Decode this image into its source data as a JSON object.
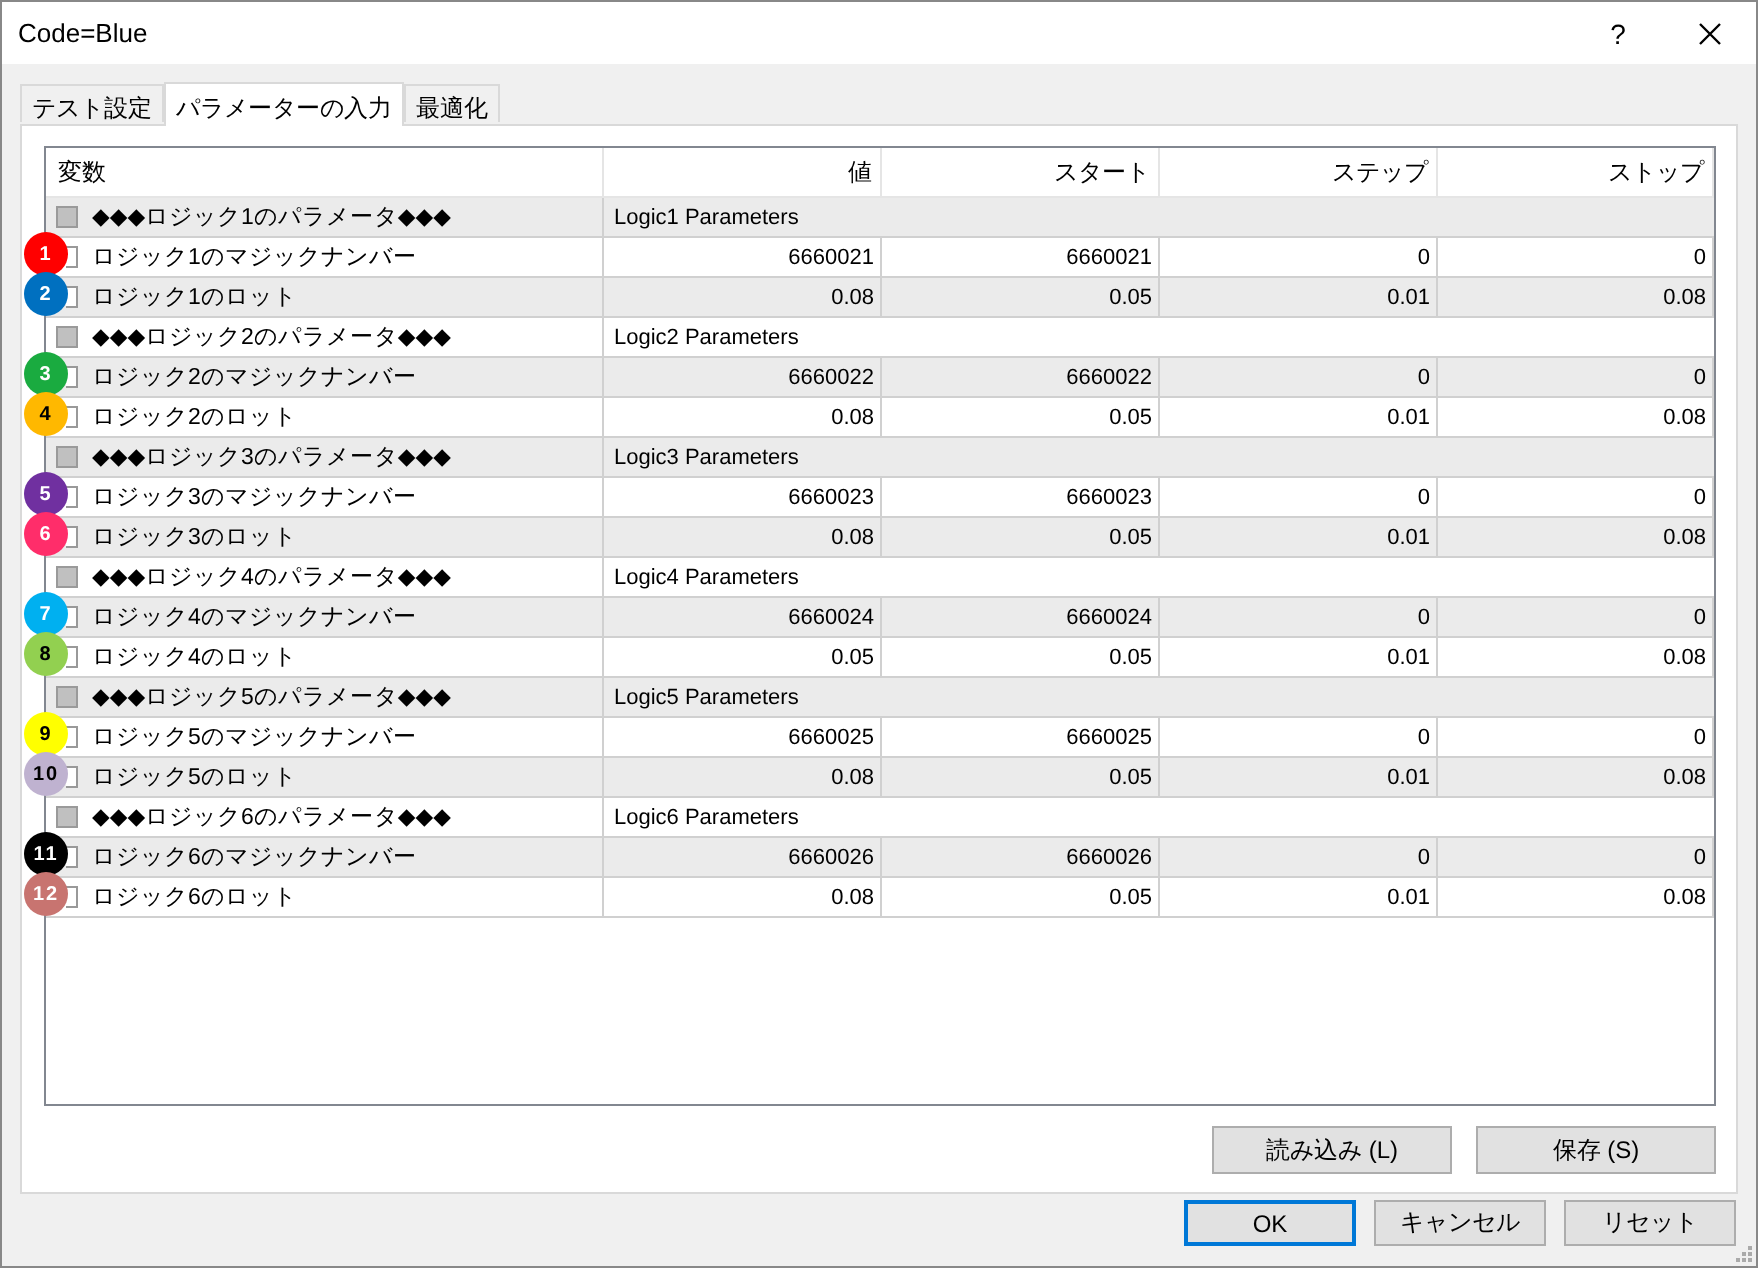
{
  "window": {
    "title": "Code=Blue",
    "help": "?"
  },
  "tabs": [
    {
      "label": "テスト設定",
      "selected": false
    },
    {
      "label": "パラメーターの入力",
      "selected": true
    },
    {
      "label": "最適化",
      "selected": false
    }
  ],
  "table": {
    "columns": [
      "変数",
      "値",
      "スタート",
      "ステップ",
      "ストップ"
    ],
    "rows": [
      {
        "kind": "group",
        "checked": false,
        "name": "◆◆◆ロジック1のパラメータ◆◆◆",
        "value": "Logic1 Parameters"
      },
      {
        "kind": "param",
        "checked": false,
        "name": "ロジック1のマジックナンバー",
        "value": "6660021",
        "start": "6660021",
        "step": "0",
        "stop": "0",
        "badge": {
          "label": "1",
          "color": "#ff0000"
        }
      },
      {
        "kind": "param",
        "checked": false,
        "name": "ロジック1のロット",
        "value": "0.08",
        "start": "0.05",
        "step": "0.01",
        "stop": "0.08",
        "badge": {
          "label": "2",
          "color": "#0070c0"
        }
      },
      {
        "kind": "group",
        "checked": false,
        "name": "◆◆◆ロジック2のパラメータ◆◆◆",
        "value": "Logic2 Parameters"
      },
      {
        "kind": "param",
        "checked": false,
        "name": "ロジック2のマジックナンバー",
        "value": "6660022",
        "start": "6660022",
        "step": "0",
        "stop": "0",
        "badge": {
          "label": "3",
          "color": "#1aab40"
        }
      },
      {
        "kind": "param",
        "checked": false,
        "name": "ロジック2のロット",
        "value": "0.08",
        "start": "0.05",
        "step": "0.01",
        "stop": "0.08",
        "badge": {
          "label": "4",
          "color": "#ffb800"
        }
      },
      {
        "kind": "group",
        "checked": false,
        "name": "◆◆◆ロジック3のパラメータ◆◆◆",
        "value": "Logic3 Parameters"
      },
      {
        "kind": "param",
        "checked": false,
        "name": "ロジック3のマジックナンバー",
        "value": "6660023",
        "start": "6660023",
        "step": "0",
        "stop": "0",
        "badge": {
          "label": "5",
          "color": "#7030a0"
        }
      },
      {
        "kind": "param",
        "checked": false,
        "name": "ロジック3のロット",
        "value": "0.08",
        "start": "0.05",
        "step": "0.01",
        "stop": "0.08",
        "badge": {
          "label": "6",
          "color": "#ff2d6a"
        }
      },
      {
        "kind": "group",
        "checked": false,
        "name": "◆◆◆ロジック4のパラメータ◆◆◆",
        "value": "Logic4 Parameters"
      },
      {
        "kind": "param",
        "checked": false,
        "name": "ロジック4のマジックナンバー",
        "value": "6660024",
        "start": "6660024",
        "step": "0",
        "stop": "0",
        "badge": {
          "label": "7",
          "color": "#00b0f0"
        }
      },
      {
        "kind": "param",
        "checked": false,
        "name": "ロジック4のロット",
        "value": "0.05",
        "start": "0.05",
        "step": "0.01",
        "stop": "0.08",
        "badge": {
          "label": "8",
          "color": "#92d050"
        }
      },
      {
        "kind": "group",
        "checked": false,
        "name": "◆◆◆ロジック5のパラメータ◆◆◆",
        "value": "Logic5 Parameters"
      },
      {
        "kind": "param",
        "checked": false,
        "name": "ロジック5のマジックナンバー",
        "value": "6660025",
        "start": "6660025",
        "step": "0",
        "stop": "0",
        "badge": {
          "label": "9",
          "color": "#ffff00"
        }
      },
      {
        "kind": "param",
        "checked": false,
        "name": "ロジック5のロット",
        "value": "0.08",
        "start": "0.05",
        "step": "0.01",
        "stop": "0.08",
        "badge": {
          "label": "10",
          "color": "#bfb2d0"
        }
      },
      {
        "kind": "group",
        "checked": false,
        "name": "◆◆◆ロジック6のパラメータ◆◆◆",
        "value": "Logic6 Parameters"
      },
      {
        "kind": "param",
        "checked": false,
        "name": "ロジック6のマジックナンバー",
        "value": "6660026",
        "start": "6660026",
        "step": "0",
        "stop": "0",
        "badge": {
          "label": "11",
          "color": "#000000"
        }
      },
      {
        "kind": "param",
        "checked": false,
        "name": "ロジック6のロット",
        "value": "0.08",
        "start": "0.05",
        "step": "0.01",
        "stop": "0.08",
        "badge": {
          "label": "12",
          "color": "#c87470"
        }
      }
    ]
  },
  "panel_buttons": [
    "読み込み (L)",
    "保存 (S)"
  ],
  "dialog_buttons": [
    {
      "label": "OK",
      "default": true
    },
    {
      "label": "キャンセル",
      "default": false
    },
    {
      "label": "リセット",
      "default": false
    }
  ]
}
